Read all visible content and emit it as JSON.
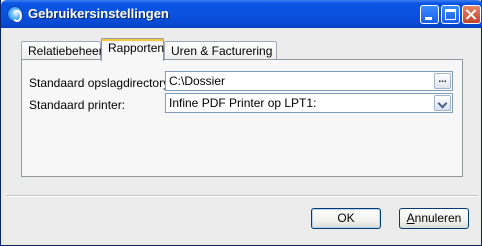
{
  "window": {
    "title": "Gebruikersinstellingen"
  },
  "tabs": [
    {
      "label": "Relatiebeheer",
      "active": false
    },
    {
      "label": "Rapporten",
      "active": true
    },
    {
      "label": "Uren & Facturering",
      "active": false
    }
  ],
  "form": {
    "storage_label": "Standaard opslagdirectory:",
    "storage_value": "C:\\Dossier",
    "browse_label": "...",
    "printer_label": "Standaard printer:",
    "printer_value": "Infine PDF Printer op LPT1:"
  },
  "footer": {
    "ok_label": "OK",
    "cancel_label_rest": "nnuleren",
    "cancel_mnemonic": "A"
  }
}
